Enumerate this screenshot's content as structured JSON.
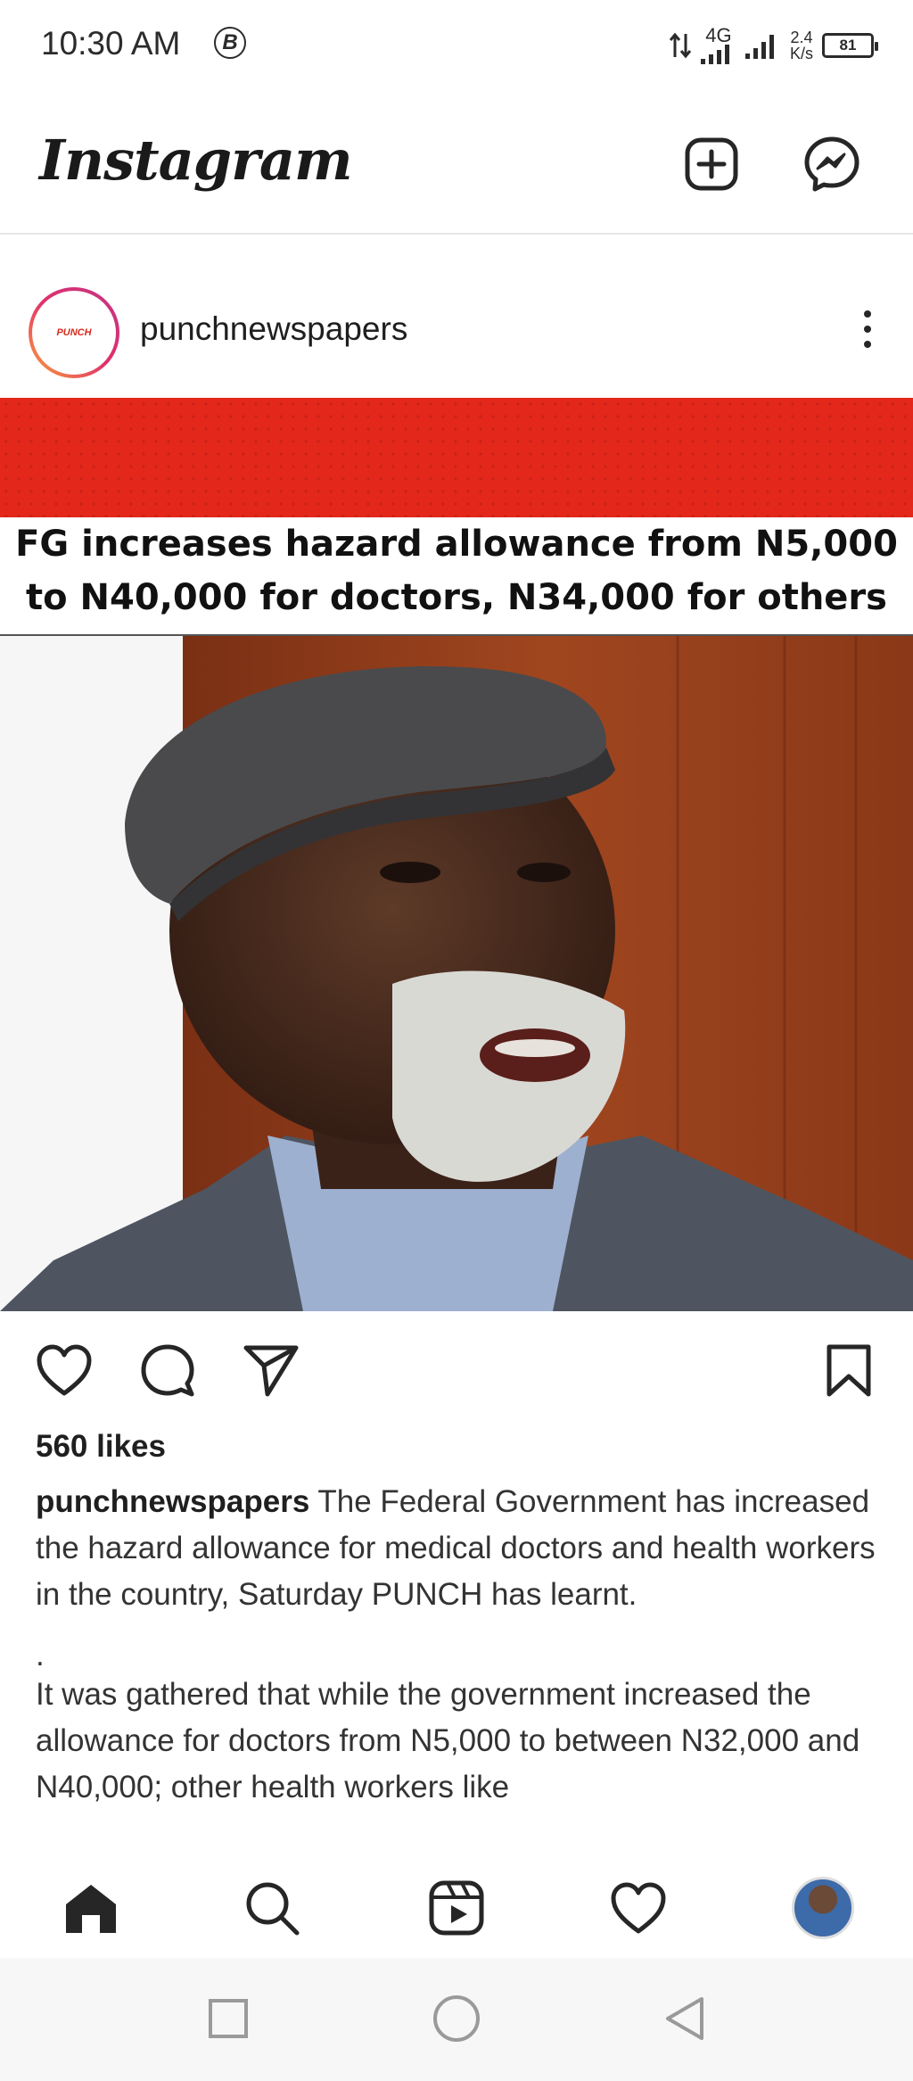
{
  "status_bar": {
    "time": "10:30 AM",
    "notification_badge": "B",
    "network_type": "4G",
    "speed_value": "2.4",
    "speed_unit": "K/s",
    "battery_level": "81"
  },
  "app": {
    "title": "Instagram",
    "header_icons": [
      "new-post-icon",
      "messenger-icon"
    ]
  },
  "post": {
    "username": "punchnewspapers",
    "avatar_label": "PUNCH",
    "media": {
      "banner_color": "#e3271b",
      "headline_line1": "FG increases hazard allowance from N5,000",
      "headline_line2": "to N40,000 for doctors, N34,000 for others"
    },
    "likes": "560 likes",
    "caption_user": "punchnewspapers",
    "caption_p1": "The Federal Government has increased the hazard allowance for medical doctors and health workers in the country, Saturday PUNCH has learnt.",
    "caption_dot": ".",
    "caption_p2": "It was gathered that while the government increased the allowance for doctors from N5,000 to between N32,000 and N40,000; other health workers like"
  },
  "bottom_nav": {
    "items": [
      "home-icon",
      "search-icon",
      "reels-icon",
      "activity-heart-icon",
      "profile-avatar"
    ]
  },
  "system_nav": {
    "items": [
      "recents-square-icon",
      "home-circle-icon",
      "back-triangle-icon"
    ]
  }
}
